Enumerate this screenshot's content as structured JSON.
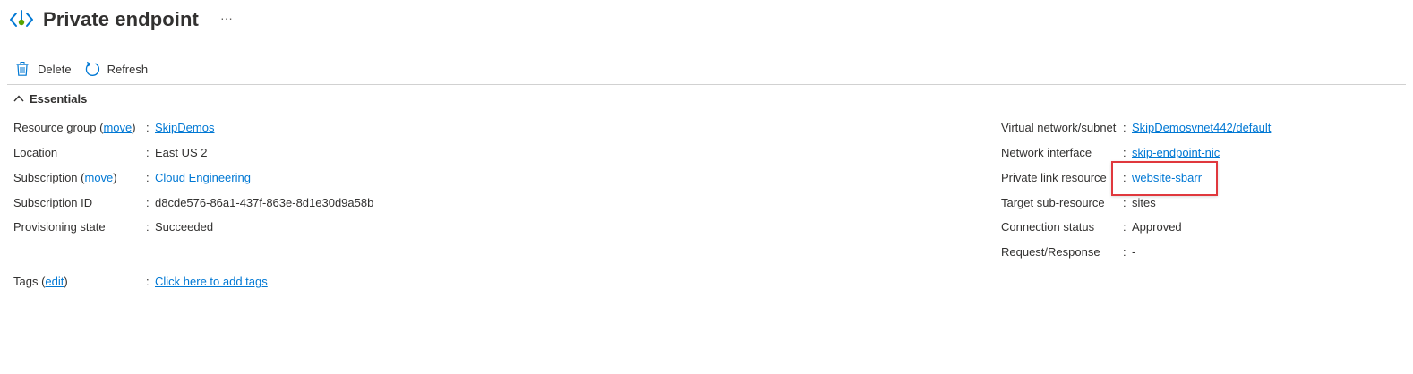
{
  "header": {
    "title": "Private endpoint",
    "more_label": "···",
    "icon": "private-endpoint-icon"
  },
  "toolbar": {
    "delete_label": "Delete",
    "refresh_label": "Refresh"
  },
  "essentials": {
    "toggle_label": "Essentials",
    "left": {
      "resource_group": {
        "label_pre": "Resource group (",
        "move": "move",
        "label_post": ")",
        "colon": ":",
        "value": "SkipDemos"
      },
      "location": {
        "label": "Location",
        "colon": ":",
        "value": "East US 2"
      },
      "subscription": {
        "label_pre": "Subscription (",
        "move": "move",
        "label_post": ")",
        "colon": ":",
        "value": "Cloud Engineering"
      },
      "subscription_id": {
        "label": "Subscription ID",
        "colon": ":",
        "value": "d8cde576-86a1-437f-863e-8d1e30d9a58b"
      },
      "provisioning_state": {
        "label": "Provisioning state",
        "colon": ":",
        "value": "Succeeded"
      }
    },
    "right": {
      "vnet_subnet": {
        "label": "Virtual network/subnet",
        "colon": ":",
        "value": "SkipDemosvnet442/default"
      },
      "network_interface": {
        "label": "Network interface",
        "colon": ":",
        "value": "skip-endpoint-nic"
      },
      "private_link_resource": {
        "label": "Private link resource",
        "colon": ":",
        "value": "website-sbarr"
      },
      "target_subresource": {
        "label": "Target sub-resource",
        "colon": ":",
        "value": "sites"
      },
      "connection_status": {
        "label": "Connection status",
        "colon": ":",
        "value": "Approved"
      },
      "request_response": {
        "label": "Request/Response",
        "colon": ":",
        "value": "-"
      }
    },
    "tags": {
      "label_pre": "Tags (",
      "edit": "edit",
      "label_post": ")",
      "colon": ":",
      "value": "Click here to add tags"
    }
  },
  "colors": {
    "link": "#0078d4",
    "text": "#323130",
    "highlight": "#e0383d",
    "icon_blue": "#0078d4",
    "icon_green": "#57a300"
  }
}
